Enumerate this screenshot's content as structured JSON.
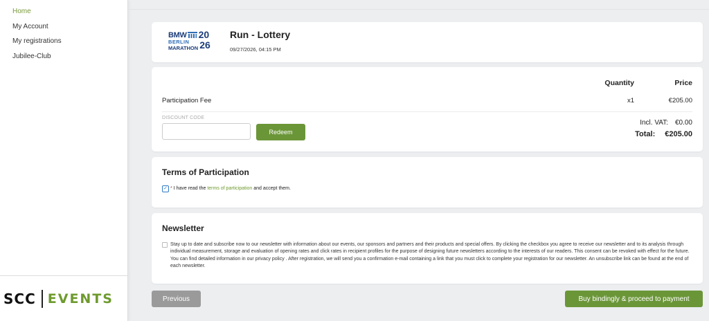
{
  "sidebar": {
    "items": [
      {
        "label": "Home",
        "active": true
      },
      {
        "label": "My Account"
      },
      {
        "label": "My registrations"
      },
      {
        "label": "Jubilee-Club"
      }
    ],
    "brand": {
      "scc": "SCC",
      "events": "EVENTS"
    }
  },
  "event": {
    "logo": {
      "bmw": "BMW",
      "year_top": "20",
      "berlin": "BERLIN",
      "marathon": "MARATHON",
      "year_bottom": "26"
    },
    "title": "Run - Lottery",
    "date": "09/27/2026, 04:15 PM"
  },
  "fee": {
    "quantity_header": "Quantity",
    "price_header": "Price",
    "item_label": "Participation Fee",
    "item_qty": "x1",
    "item_price": "€205.00",
    "discount_label": "DISCOUNT CODE",
    "discount_value": "",
    "redeem_label": "Redeem",
    "vat_label": "Incl. VAT:",
    "vat_value": "€0.00",
    "total_label": "Total:",
    "total_value": "€205.00"
  },
  "terms": {
    "title": "Terms of Participation",
    "checked": true,
    "checkmark": "✓",
    "required_mark": "*",
    "text_before": " I have read the ",
    "link_text": "terms of participation",
    "text_after": " and accept them."
  },
  "newsletter": {
    "title": "Newsletter",
    "checked": false,
    "text": "Stay up to date and subscribe now to our newsletter with information about our events, our sponsors and partners and their products and special offers. By clicking the checkbox you agree to receive our newsletter and to its analysis through individual measurement, storage and evaluation of opening rates and click rates in recipient profiles for the purpose of designing future newsletters according to the interests of our readers. This consent can be revoked with effect for the future. You can find detailed information in our privacy policy . After registration, we will send you a confirmation e-mail containing a link that you must click to complete your registration for our newsletter. An unsubscribe link can be found at the end of each newsletter."
  },
  "footer": {
    "previous_label": "Previous",
    "buy_label": "Buy bindingly & proceed to payment"
  },
  "colors": {
    "accent_green": "#6b9638",
    "link_green": "#6e9a2e",
    "bmw_blue": "#1b3c7a",
    "checkbox_blue": "#2f7ac6",
    "background": "#eceef0"
  }
}
